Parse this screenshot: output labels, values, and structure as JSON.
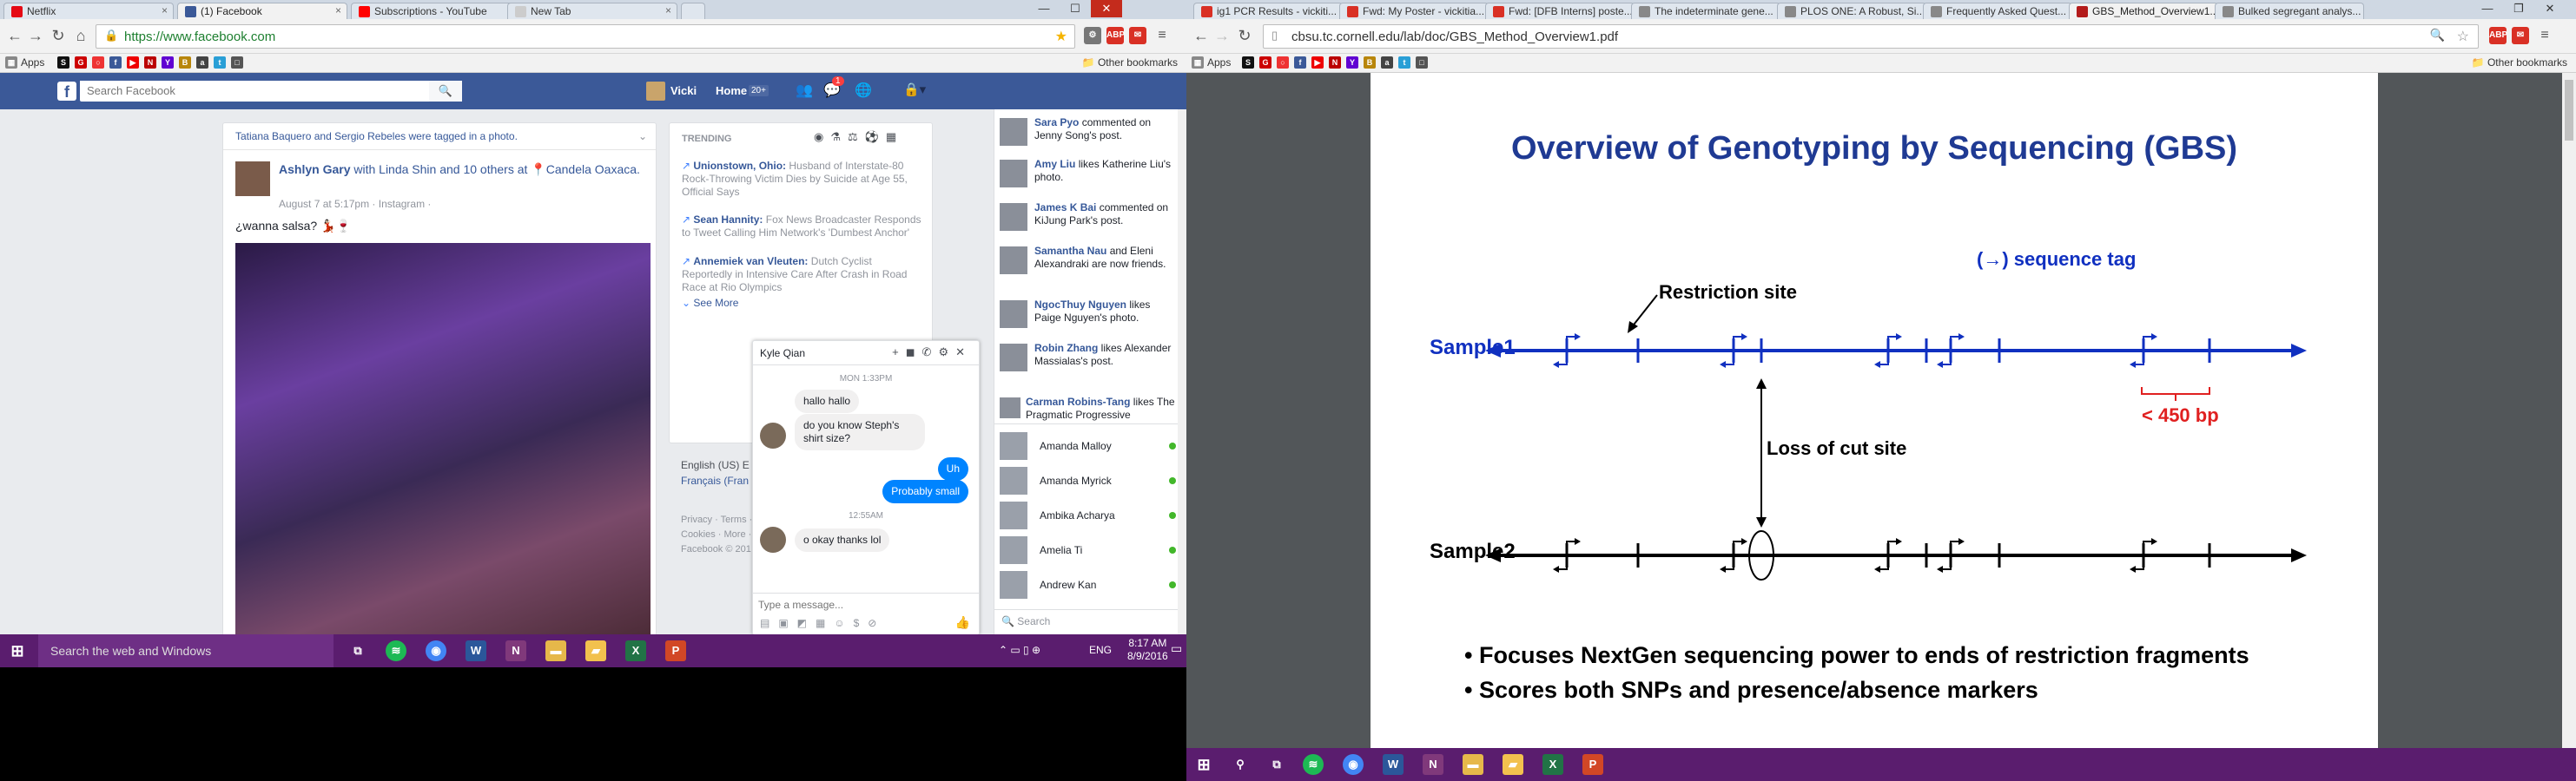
{
  "left": {
    "tabs": [
      {
        "label": "Netflix",
        "color": "#e50914"
      },
      {
        "label": "(1) Facebook",
        "color": "#3b5998"
      },
      {
        "label": "Subscriptions - YouTube",
        "color": "#ff0000"
      },
      {
        "label": "New Tab",
        "color": "#cccccc"
      }
    ],
    "url": "https://www.facebook.com",
    "bookmarks_label": "Apps",
    "other_bookmarks": "Other bookmarks",
    "fb": {
      "search_placeholder": "Search Facebook",
      "user_name": "Vicki",
      "home": "Home",
      "home_count": "20+",
      "notif_count": "1",
      "tagged_line": "Tatiana Baquero and Sergio Rebeles were tagged in a photo.",
      "post_author": "Ashlyn Gary",
      "post_with": "with Linda Shin and 10 others at",
      "post_place": "Candela Oaxaca.",
      "post_time": "August 7 at 5:17pm · Instagram · ",
      "post_text": "¿wanna salsa? 💃🏻🍷",
      "trending_title": "TRENDING",
      "trending": [
        {
          "topic": "Unionstown, Ohio:",
          "desc": "Husband of Interstate-80 Rock-Throwing Victim Dies by Suicide at Age 55, Official Says"
        },
        {
          "topic": "Sean Hannity:",
          "desc": "Fox News Broadcaster Responds to Tweet Calling Him Network's 'Dumbest Anchor'"
        },
        {
          "topic": "Annemiek van Vleuten:",
          "desc": "Dutch Cyclist Reportedly in Intensive Care After Crash in Road Race at Rio Olympics"
        }
      ],
      "see_more": "See More",
      "lang_line1": "English (US)  E",
      "lang_line2": "Français (Fran",
      "footer1": "Privacy · Terms ·",
      "footer2": "Cookies · More ·",
      "footer3": "Facebook © 201",
      "ticker": [
        {
          "name": "Sara Pyo",
          "text": "commented on Jenny Song's post."
        },
        {
          "name": "Amy Liu",
          "text": "likes Katherine Liu's photo."
        },
        {
          "name": "James K Bai",
          "text": "commented on KiJung Park's post."
        },
        {
          "name": "Samantha Nau",
          "text": "and Eleni Alexandraki are now friends."
        },
        {
          "name": "NgocThuy Nguyen",
          "text": "likes Paige Nguyen's photo."
        },
        {
          "name": "Robin Zhang",
          "text": "likes Alexander Massialas's post."
        },
        {
          "name": "Carman Robins-Tang",
          "text": "likes The Pragmatic Progressive"
        }
      ],
      "online": [
        "Amanda Malloy",
        "Amanda Myrick",
        "Ambika Acharya",
        "Amelia Ti",
        "Andrew Kan"
      ],
      "chat_search": "Search",
      "chat": {
        "name": "Kyle Qian",
        "day": "MON 1:33PM",
        "msg1": "hallo hallo",
        "msg2": "do you know Steph's shirt size?",
        "msg3": "Uh",
        "msg4": "Probably small",
        "time2": "12:55AM",
        "msg5": "o okay thanks lol",
        "input_placeholder": "Type a message..."
      }
    },
    "taskbar": {
      "search": "Search the web and Windows",
      "lang": "ENG",
      "time": "8:17 AM",
      "date": "8/9/2016"
    }
  },
  "right": {
    "tabs": [
      "ig1 PCR Results - vickiti...",
      "Fwd: My Poster - vickitia...",
      "Fwd: [DFB Interns] poste...",
      "The indeterminate gene...",
      "PLOS ONE: A Robust, Si...",
      "Frequently Asked Quest...",
      "GBS_Method_Overview1...",
      "Bulked segregant analys..."
    ],
    "url": "cbsu.tc.cornell.edu/lab/doc/GBS_Method_Overview1.pdf",
    "bookmarks_label": "Apps",
    "other_bookmarks": "Other bookmarks",
    "pdf": {
      "title": "Overview of Genotyping by Sequencing (GBS)",
      "seq_tag_arrow": "(→)",
      "seq_tag": "sequence tag",
      "restriction": "Restriction site",
      "sample1": "Sample1",
      "sample2": "Sample2",
      "loss": "Loss of cut site",
      "bp": "< 450 bp",
      "bullet1": "Focuses NextGen sequencing power to ends of restriction fragments",
      "bullet2": "Scores both SNPs and presence/absence markers",
      "colors": {
        "title": "#1f3a93",
        "blue": "#1030c0",
        "red": "#e02020"
      }
    }
  }
}
